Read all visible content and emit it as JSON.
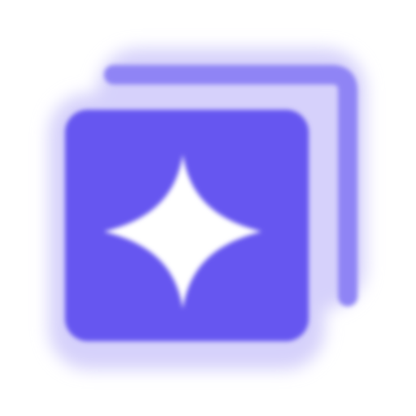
{
  "icon": {
    "name": "sparkle-stack-icon",
    "accent": "#6657f0",
    "accent_soft": "#8f84f5",
    "glow": "#d6d1fb",
    "star_color": "#ffffff",
    "background": "#ffffff"
  }
}
